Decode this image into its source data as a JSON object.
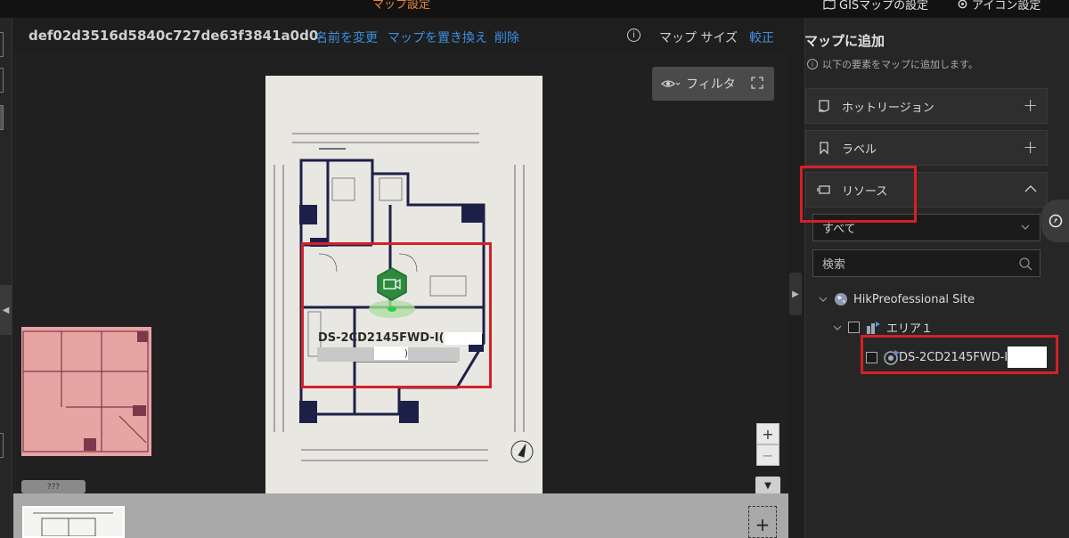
{
  "topbar": {
    "active_tab": "マップ設定",
    "gis_settings": "GISマップの設定",
    "icon_settings": "アイコン設定"
  },
  "header": {
    "map_id": "def02d3516d5840c727de63f3841a0d0",
    "rename": "名前を変更",
    "replace_map": "マップを置き換え",
    "delete": "削除",
    "map_size": "マップ サイズ",
    "calibrate": "較正"
  },
  "canvas": {
    "filter": "フィルタ",
    "device_label": "DS-2CD2145FWD-I(",
    "device_label_suffix": ")",
    "minimap_tag": "???",
    "zoom_in": "+",
    "zoom_out": "−",
    "add_map": "+"
  },
  "panel": {
    "title": "マップに追加",
    "hint": "以下の要素をマップに追加します。",
    "sections": {
      "hot_region": "ホットリージョン",
      "label": "ラベル",
      "resource": "リソース"
    },
    "filter_select": "すべて",
    "search_placeholder": "検索",
    "tree": {
      "site": "HikPreofessional Site",
      "area": "エリア１",
      "device": "DS-2CD2145FWD-I"
    }
  },
  "colors": {
    "accent_link": "#3d8fe0",
    "active_tab": "#e8863a",
    "highlight_box": "#d42028",
    "camera_icon": "#2e8b3e"
  }
}
